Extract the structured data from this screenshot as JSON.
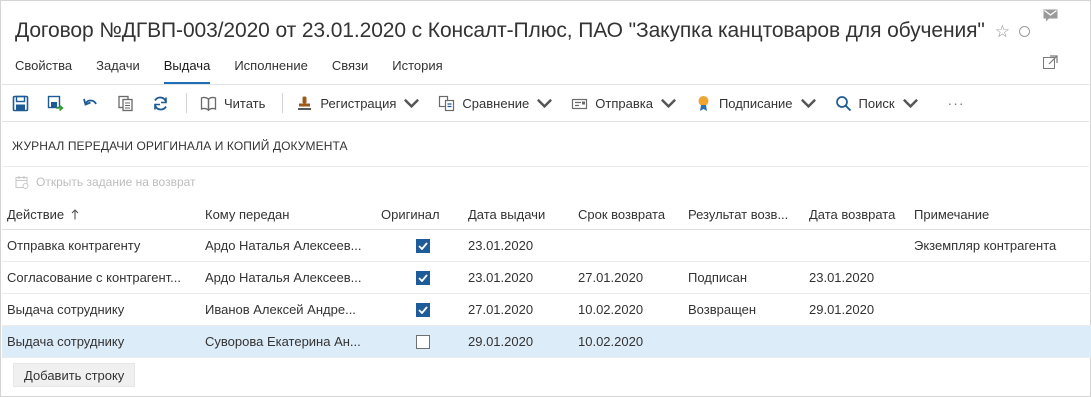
{
  "header": {
    "title": "Договор №ДГВП-003/2020 от 23.01.2020 с Консалт-Плюс, ПАО \"Закупка канцтоваров для обучения\""
  },
  "tabs": [
    {
      "label": "Свойства",
      "active": false
    },
    {
      "label": "Задачи",
      "active": false
    },
    {
      "label": "Выдача",
      "active": true
    },
    {
      "label": "Исполнение",
      "active": false
    },
    {
      "label": "Связи",
      "active": false
    },
    {
      "label": "История",
      "active": false
    }
  ],
  "toolbar": {
    "read": "Читать",
    "registration": "Регистрация",
    "compare": "Сравнение",
    "send": "Отправка",
    "sign": "Подписание",
    "search": "Поиск",
    "more": "···"
  },
  "section": {
    "title": "ЖУРНАЛ ПЕРЕДАЧИ ОРИГИНАЛА И КОПИЙ ДОКУМЕНТА",
    "open_task": "Открыть задание на возврат"
  },
  "table": {
    "columns": [
      "Действие",
      "Кому передан",
      "Оригинал",
      "Дата выдачи",
      "Срок возврата",
      "Результат возв...",
      "Дата возврата",
      "Примечание"
    ],
    "rows": [
      {
        "action": "Отправка контрагенту",
        "to": "Ардо Наталья Алексеев...",
        "original": true,
        "issue_date": "23.01.2020",
        "due_date": "",
        "result": "",
        "return_date": "",
        "note": "Экземпляр контрагента"
      },
      {
        "action": "Согласование с контрагент...",
        "to": "Ардо Наталья Алексеев...",
        "original": true,
        "issue_date": "23.01.2020",
        "due_date": "27.01.2020",
        "result": "Подписан",
        "return_date": "23.01.2020",
        "note": ""
      },
      {
        "action": "Выдача сотруднику",
        "to": "Иванов Алексей Андре...",
        "original": true,
        "issue_date": "27.01.2020",
        "due_date": "10.02.2020",
        "result": "Возвращен",
        "return_date": "29.01.2020",
        "note": ""
      },
      {
        "action": "Выдача сотруднику",
        "to": "Суворова Екатерина Ан...",
        "original": false,
        "issue_date": "29.01.2020",
        "due_date": "10.02.2020",
        "result": "",
        "return_date": "",
        "note": ""
      }
    ],
    "add_row": "Добавить строку"
  },
  "colors": {
    "accent": "#1e6fb6",
    "selected_row": "#dcecf9",
    "checkbox_checked": "#1d5c99"
  },
  "icons": {
    "save": "save-icon",
    "save_and_close": "save-close-icon",
    "undo": "undo-icon",
    "copy": "copy-icon",
    "refresh": "refresh-icon",
    "read": "book-icon",
    "registration": "stamp-icon",
    "compare": "compare-icon",
    "send": "send-icon",
    "sign": "sign-icon",
    "search": "search-icon",
    "mail": "mail-icon",
    "open_external": "open-external-icon"
  }
}
